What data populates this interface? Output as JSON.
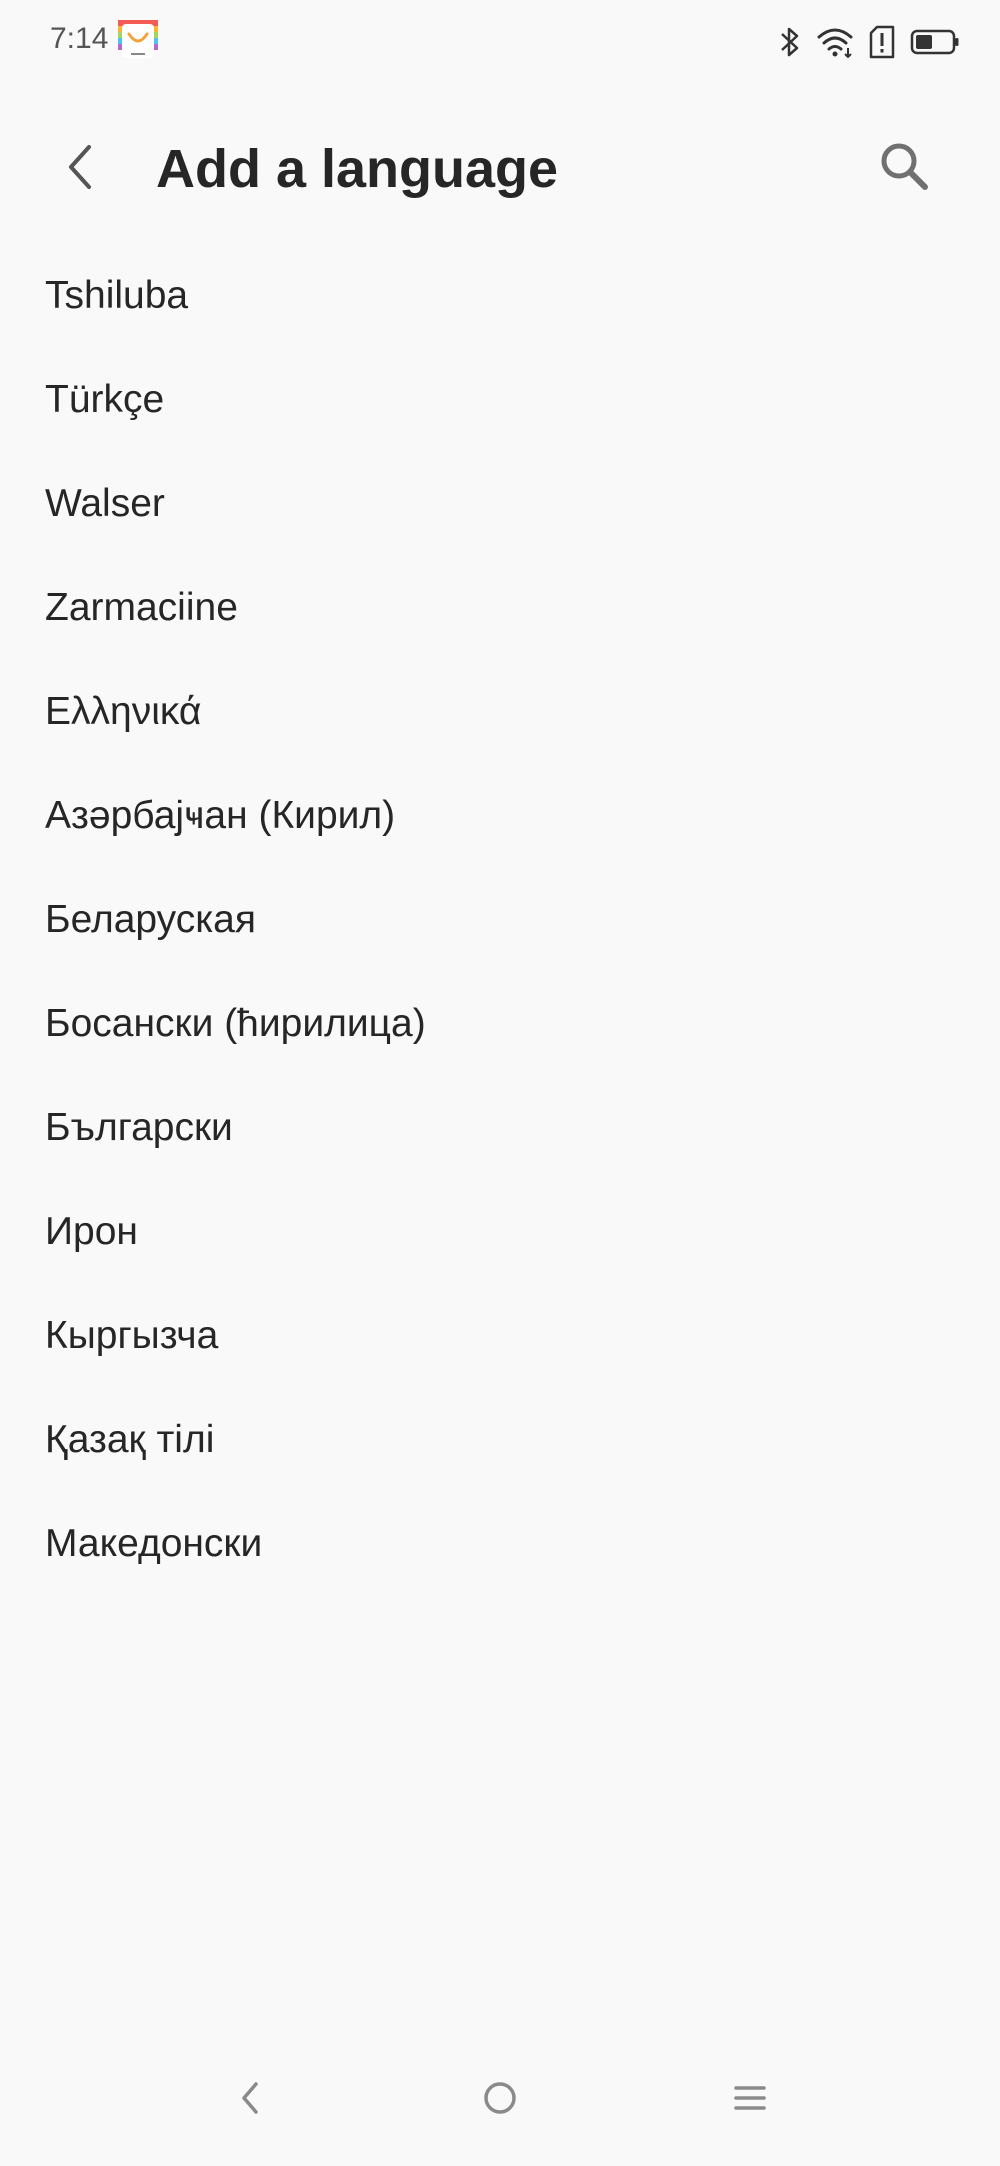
{
  "status_bar": {
    "time": "7:14",
    "icons": [
      "app-notification-icon",
      "bluetooth-icon",
      "wifi-icon",
      "sim-alert-icon",
      "battery-icon"
    ]
  },
  "header": {
    "title": "Add a language",
    "back_icon": "back-arrow-icon",
    "search_icon": "search-icon"
  },
  "languages": [
    {
      "label": "Tshiluba"
    },
    {
      "label": "Türkçe"
    },
    {
      "label": "Walser"
    },
    {
      "label": "Zarmaciine"
    },
    {
      "label": "Ελληνικά"
    },
    {
      "label": "Азәрбајҹан (Кирил)"
    },
    {
      "label": "Беларуская"
    },
    {
      "label": "Босански (ћирилица)"
    },
    {
      "label": "Български"
    },
    {
      "label": "Ирон"
    },
    {
      "label": "Кыргызча"
    },
    {
      "label": "Қазақ тілі"
    },
    {
      "label": "Македонски"
    }
  ],
  "nav_bar": {
    "icons": [
      "nav-back-icon",
      "nav-home-icon",
      "nav-menu-icon"
    ]
  },
  "colors": {
    "background": "#f9f9f9",
    "text_primary": "#262626",
    "icon_gray": "#707070"
  }
}
